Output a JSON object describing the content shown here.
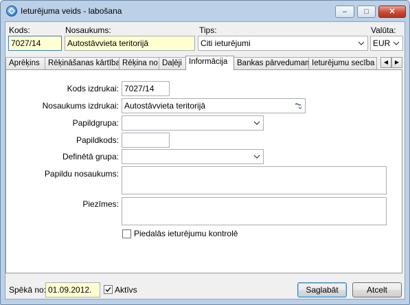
{
  "window": {
    "title": "Ieturējuma veids - labošana",
    "minimize_glyph": "–",
    "maximize_glyph": "□",
    "close_glyph": "✕"
  },
  "header": {
    "kods_label": "Kods:",
    "kods_value": "7027/14",
    "nosaukums_label": "Nosaukums:",
    "nosaukums_value": "Autostāvvieta teritorijā",
    "tips_label": "Tips:",
    "tips_value": "Citi ieturējumi",
    "valuta_label": "Valūta:",
    "valuta_value": "EUR"
  },
  "tabs": [
    {
      "label": "Aprēķins"
    },
    {
      "label": "Rēķināšanas kārtība"
    },
    {
      "label": "Rēķina no"
    },
    {
      "label": "Daļēji"
    },
    {
      "label": "Informācija"
    },
    {
      "label": "Bankas pārvedumam"
    },
    {
      "label": "Ieturējumu secība"
    }
  ],
  "tab_scroll": {
    "left": "◀",
    "right": "▶"
  },
  "info": {
    "kods_izdrukai_label": "Kods izdrukai:",
    "kods_izdrukai_value": "7027/14",
    "nosaukums_izdrukai_label": "Nosaukums izdrukai:",
    "nosaukums_izdrukai_value": "Autostāvvieta teritorijā",
    "papildgrupa_label": "Papildgrupa:",
    "papildgrupa_value": "",
    "papildkods_label": "Papildkods:",
    "papildkods_value": "",
    "defineta_grupa_label": "Definētā grupa:",
    "defineta_grupa_value": "",
    "papildu_nosaukums_label": "Papildu nosaukums:",
    "papildu_nosaukums_value": "",
    "piezimes_label": "Piezīmes:",
    "piezimes_value": "",
    "kontrole_label": "Piedalās ieturējumu kontrolē",
    "kontrole_checked": false
  },
  "footer": {
    "speka_no_label": "Spēkā no:",
    "speka_no_value": "01.09.2012.",
    "aktivs_label": "Aktīvs",
    "aktivs_checked": true,
    "save_label": "Saglabāt",
    "cancel_label": "Atcelt"
  },
  "colors": {
    "accent": "#3c7fb1",
    "required_field": "#ffffd2",
    "frame": "#bcd0e7"
  }
}
